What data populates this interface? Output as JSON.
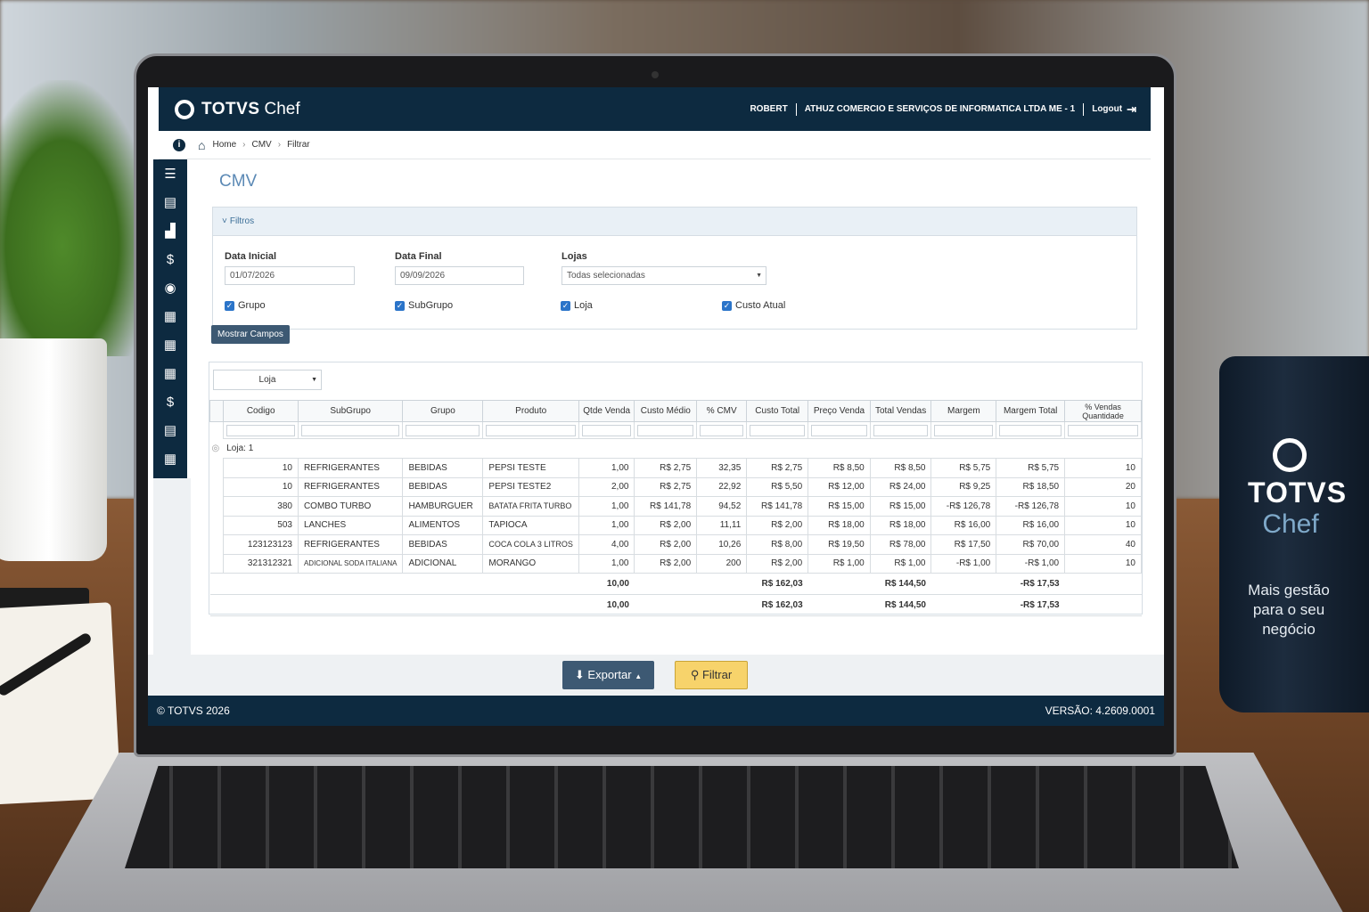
{
  "app": {
    "brand_bold": "TOTVS",
    "brand_light": "Chef"
  },
  "topbar": {
    "user": "ROBERT",
    "company": "ATHUZ COMERCIO E SERVIÇOS DE INFORMATICA LTDA ME - 1",
    "logout": "Logout"
  },
  "breadcrumb": [
    "Home",
    "CMV",
    "Filtrar"
  ],
  "page": {
    "title": "CMV"
  },
  "filters": {
    "header": "Filtros",
    "data_inicial_label": "Data Inicial",
    "data_inicial_value": "01/07/2026",
    "data_final_label": "Data Final",
    "data_final_value": "09/09/2026",
    "lojas_label": "Lojas",
    "lojas_value": "Todas selecionadas",
    "checkboxes": [
      "Grupo",
      "SubGrupo",
      "Loja",
      "Custo Atual"
    ],
    "show_fields": "Mostrar Campos"
  },
  "grid": {
    "group_by": "Loja",
    "columns": [
      "Codigo",
      "SubGrupo",
      "Grupo",
      "Produto",
      "Qtde Venda",
      "Custo Médio",
      "% CMV",
      "Custo Total",
      "Preço Venda",
      "Total Vendas",
      "Margem",
      "Margem Total",
      "% Vendas Quantidade"
    ],
    "group_label": "Loja: 1",
    "rows": [
      [
        "10",
        "REFRIGERANTES",
        "BEBIDAS",
        "PEPSI TESTE",
        "1,00",
        "R$ 2,75",
        "32,35",
        "R$ 2,75",
        "R$ 8,50",
        "R$ 8,50",
        "R$ 5,75",
        "R$ 5,75",
        "10"
      ],
      [
        "10",
        "REFRIGERANTES",
        "BEBIDAS",
        "PEPSI TESTE2",
        "2,00",
        "R$ 2,75",
        "22,92",
        "R$ 5,50",
        "R$ 12,00",
        "R$ 24,00",
        "R$ 9,25",
        "R$ 18,50",
        "20"
      ],
      [
        "380",
        "COMBO TURBO",
        "HAMBURGUER",
        "BATATA FRITA TURBO",
        "1,00",
        "R$ 141,78",
        "94,52",
        "R$ 141,78",
        "R$ 15,00",
        "R$ 15,00",
        "-R$ 126,78",
        "-R$ 126,78",
        "10"
      ],
      [
        "503",
        "LANCHES",
        "ALIMENTOS",
        "TAPIOCA",
        "1,00",
        "R$ 2,00",
        "11,11",
        "R$ 2,00",
        "R$ 18,00",
        "R$ 18,00",
        "R$ 16,00",
        "R$ 16,00",
        "10"
      ],
      [
        "123123123",
        "REFRIGERANTES",
        "BEBIDAS",
        "COCA COLA 3 LITROS",
        "4,00",
        "R$ 2,00",
        "10,26",
        "R$ 8,00",
        "R$ 19,50",
        "R$ 78,00",
        "R$ 17,50",
        "R$ 70,00",
        "40"
      ],
      [
        "321312321",
        "ADICIONAL SODA ITALIANA",
        "ADICIONAL",
        "MORANGO",
        "1,00",
        "R$ 2,00",
        "200",
        "R$ 2,00",
        "R$ 1,00",
        "R$ 1,00",
        "-R$ 1,00",
        "-R$ 1,00",
        "10"
      ]
    ],
    "subtotal": {
      "qtde": "10,00",
      "custo_total": "R$ 162,03",
      "total_vendas": "R$ 144,50",
      "margem_total": "-R$ 17,53"
    },
    "total": {
      "qtde": "10,00",
      "custo_total": "R$ 162,03",
      "total_vendas": "R$ 144,50",
      "margem_total": "-R$ 17,53"
    }
  },
  "actions": {
    "export": "Exportar",
    "filter": "Filtrar"
  },
  "footer": {
    "copyright": "© TOTVS 2026",
    "version": "VERSÃO: 4.2609.0001"
  },
  "mug": {
    "brand": "TOTVS",
    "sub": "Chef",
    "tagline": "Mais gestão para o seu negócio"
  },
  "colors": {
    "navy": "#0d2a40",
    "accent_blue": "#5b89b5",
    "filter_button": "#f7d36b"
  }
}
